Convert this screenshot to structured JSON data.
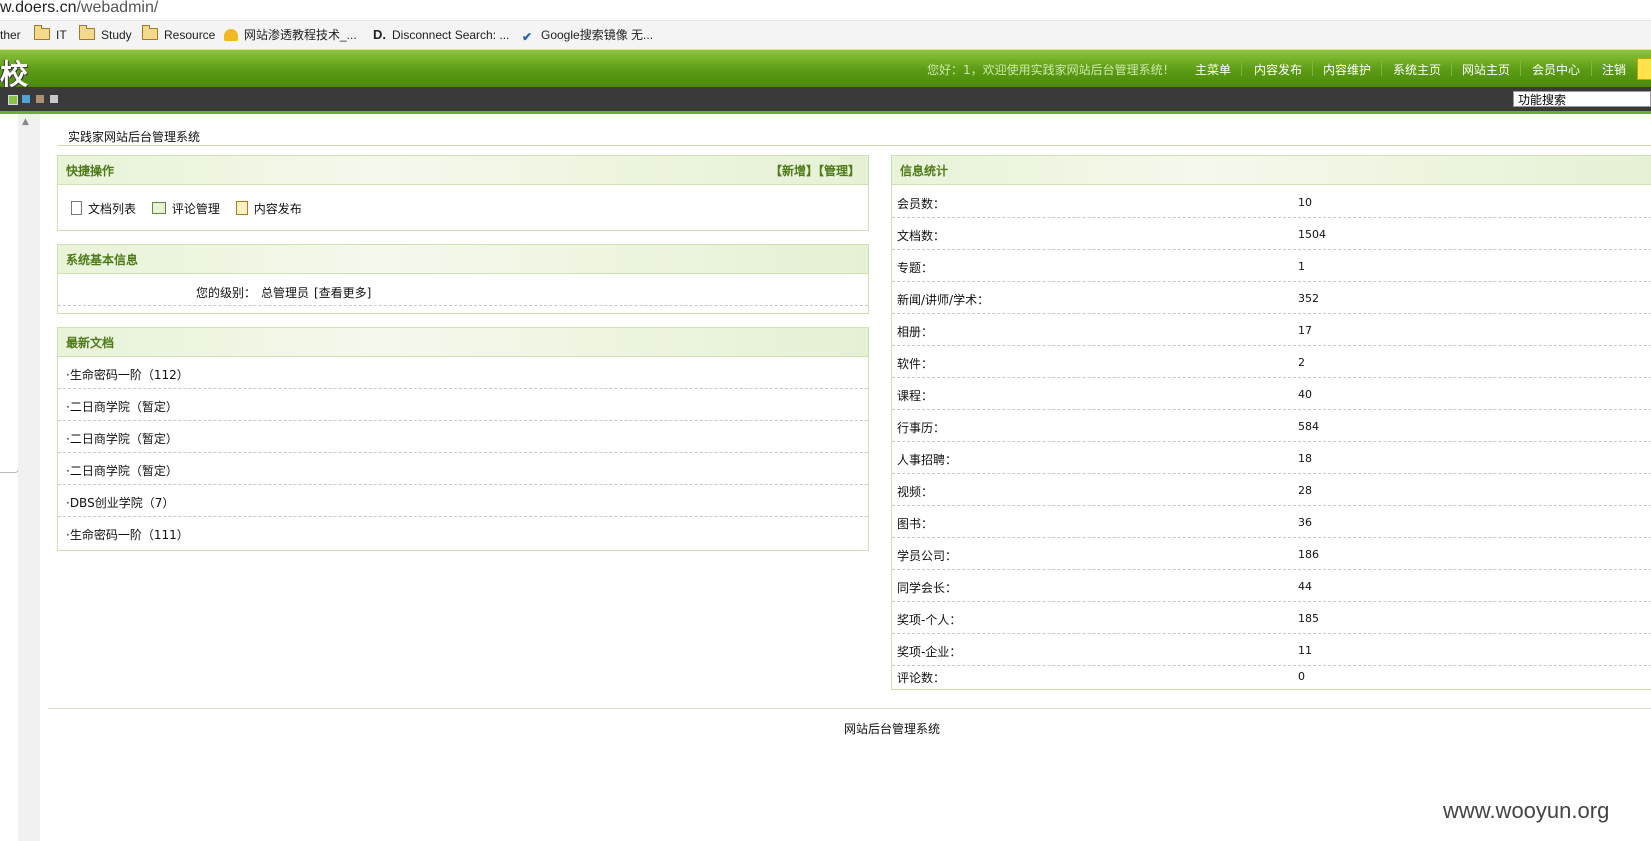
{
  "browser": {
    "url_host": "w.doers.cn",
    "url_path": "/webadmin/",
    "bookmarks": [
      {
        "label": "ther",
        "icon": "folder-icon"
      },
      {
        "label": "IT",
        "icon": "folder-icon"
      },
      {
        "label": "Study",
        "icon": "folder-icon"
      },
      {
        "label": "Resource",
        "icon": "folder-icon"
      },
      {
        "label": "网站渗透教程技术_...",
        "icon": "hat-icon"
      },
      {
        "label": "Disconnect Search: ...",
        "icon": "disconnect-icon"
      },
      {
        "label": "Google搜索镜像 无...",
        "icon": "google-mirror-icon"
      }
    ]
  },
  "header": {
    "logo_text": "校",
    "welcome": "您好：1，欢迎使用实践家网站后台管理系统！",
    "nav": [
      "主菜单",
      "内容发布",
      "内容维护",
      "系统主页",
      "网站主页",
      "会员中心",
      "注销"
    ],
    "search_value": "功能搜索"
  },
  "page": {
    "title": "实践家网站后台管理系统",
    "footer": "网站后台管理系统"
  },
  "quick_ops": {
    "title": "快捷操作",
    "actions": "【新增】【管理】",
    "links": [
      "文档列表",
      "评论管理",
      "内容发布"
    ]
  },
  "sys_info": {
    "title": "系统基本信息",
    "level_label": "您的级别：",
    "level_value": "总管理员",
    "more": "[查看更多]"
  },
  "latest_docs": {
    "title": "最新文档",
    "items": [
      "·生命密码一阶（112）",
      "·二日商学院（暂定）",
      "·二日商学院（暂定）",
      "·二日商学院（暂定）",
      "·DBS创业学院（7）",
      "·生命密码一阶（111）"
    ]
  },
  "stats": {
    "title": "信息统计",
    "rows": [
      {
        "label": "会员数：",
        "value": "10"
      },
      {
        "label": "文档数：",
        "value": "1504"
      },
      {
        "label": "专题：",
        "value": "1"
      },
      {
        "label": "新闻/讲师/学术：",
        "value": "352"
      },
      {
        "label": "相册：",
        "value": "17"
      },
      {
        "label": "软件：",
        "value": "2"
      },
      {
        "label": "课程：",
        "value": "40"
      },
      {
        "label": "行事历：",
        "value": "584"
      },
      {
        "label": "人事招聘：",
        "value": "18"
      },
      {
        "label": "视频：",
        "value": "28"
      },
      {
        "label": "图书：",
        "value": "36"
      },
      {
        "label": "学员公司：",
        "value": "186"
      },
      {
        "label": "同学会长：",
        "value": "44"
      },
      {
        "label": "奖项-个人：",
        "value": "185"
      },
      {
        "label": "奖项-企业：",
        "value": "11"
      },
      {
        "label": "评论数：",
        "value": "0"
      }
    ]
  },
  "watermark": "www.wooyun.org",
  "colors": {
    "header_green": "#5a9a14",
    "panel_title": "#4f7a1a",
    "dark_bar": "#3a3a3a"
  }
}
